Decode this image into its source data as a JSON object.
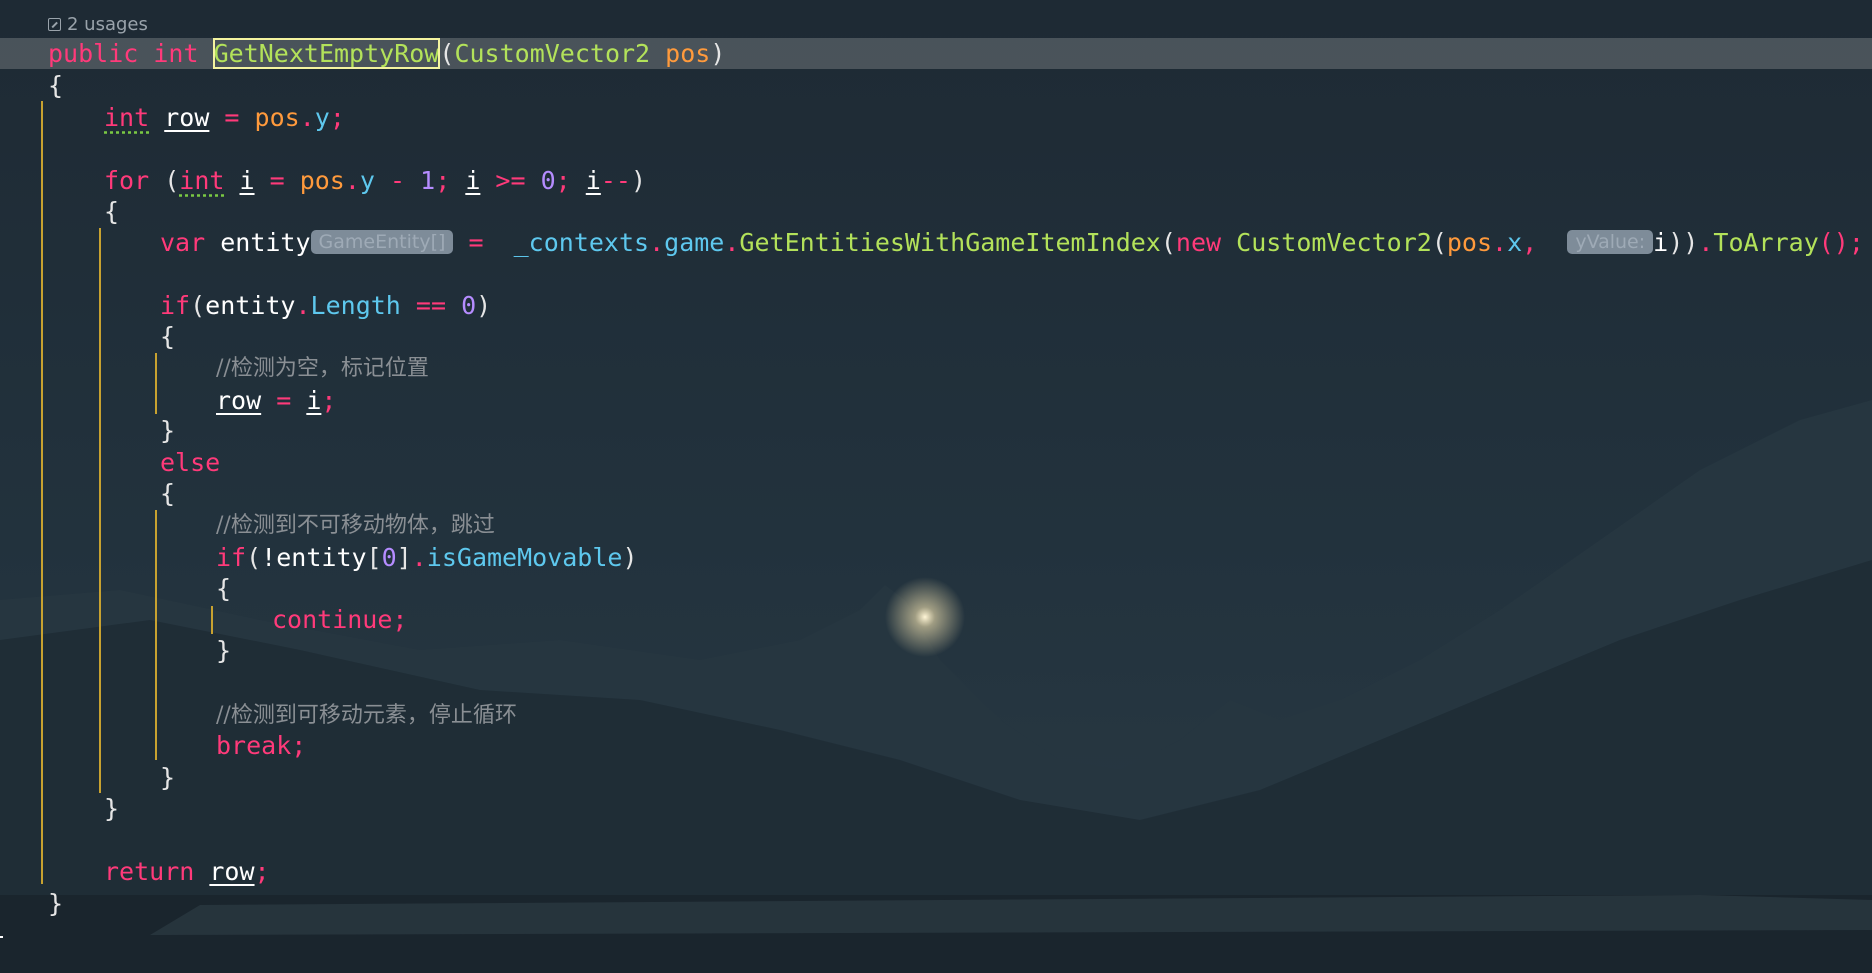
{
  "usages": {
    "icon": "open-external-icon",
    "label": "2 usages"
  },
  "code": {
    "l1": {
      "public": "public",
      "int": "int",
      "method": "GetNextEmptyRow",
      "open": "(",
      "type": "CustomVector2",
      "param": "pos",
      "close": ")"
    },
    "l2": "{",
    "l3": {
      "int": "int",
      "row": "row",
      "eq": " = ",
      "pos": "pos",
      "dot": ".",
      "y": "y",
      "semi": ";"
    },
    "l5": {
      "for": "for",
      "open": " (",
      "int": "int",
      "i1": "i",
      "eq": " = ",
      "pos": "pos",
      "dot": ".",
      "y": "y",
      "minus": " - ",
      "one": "1",
      "semi1": "; ",
      "i2": "i",
      "ge": " >= ",
      "zero": "0",
      "semi2": "; ",
      "i3": "i",
      "dec": "--",
      "close": ")"
    },
    "l6": "{",
    "l7": {
      "var": "var",
      "entity": "entity",
      "hint_type": "GameEntity[]",
      "eq": " = ",
      "contexts": "_contexts",
      "d1": ".",
      "game": "game",
      "d2": ".",
      "call": "GetEntitiesWithGameItemIndex",
      "p1": "(",
      "new": "new",
      "ctor": "CustomVector2",
      "p2": "(",
      "pos": "pos",
      "d3": ".",
      "x": "x",
      "comma": ",",
      "hint_param": "yValue:",
      "i": "i",
      "p3": "))",
      "d4": ".",
      "toarray": "ToArray",
      "end": "();"
    },
    "l9": {
      "if": "if",
      "open": "(",
      "entity": "entity",
      "dot": ".",
      "length": "Length",
      "eqeq": " == ",
      "zero": "0",
      "close": ")"
    },
    "l10": "{",
    "l11": "//检测为空，标记位置",
    "l12": {
      "row": "row",
      "eq": " = ",
      "i": "i",
      "semi": ";"
    },
    "l13": "}",
    "l14": "else",
    "l15": "{",
    "l16": "//检测到不可移动物体，跳过",
    "l17": {
      "if": "if",
      "open": "(",
      "not": "!",
      "entity": "entity",
      "br1": "[",
      "zero": "0",
      "br2": "]",
      "dot": ".",
      "prop": "isGameMovable",
      "close": ")"
    },
    "l18": "{",
    "l19": {
      "kw": "continue",
      "semi": ";"
    },
    "l20": "}",
    "l22": "//检测到可移动元素，停止循环",
    "l23": {
      "kw": "break",
      "semi": ";"
    },
    "l24": "}",
    "l25": "}",
    "l27": {
      "kw": "return",
      "row": "row",
      "semi": ";"
    },
    "l28": "}"
  }
}
